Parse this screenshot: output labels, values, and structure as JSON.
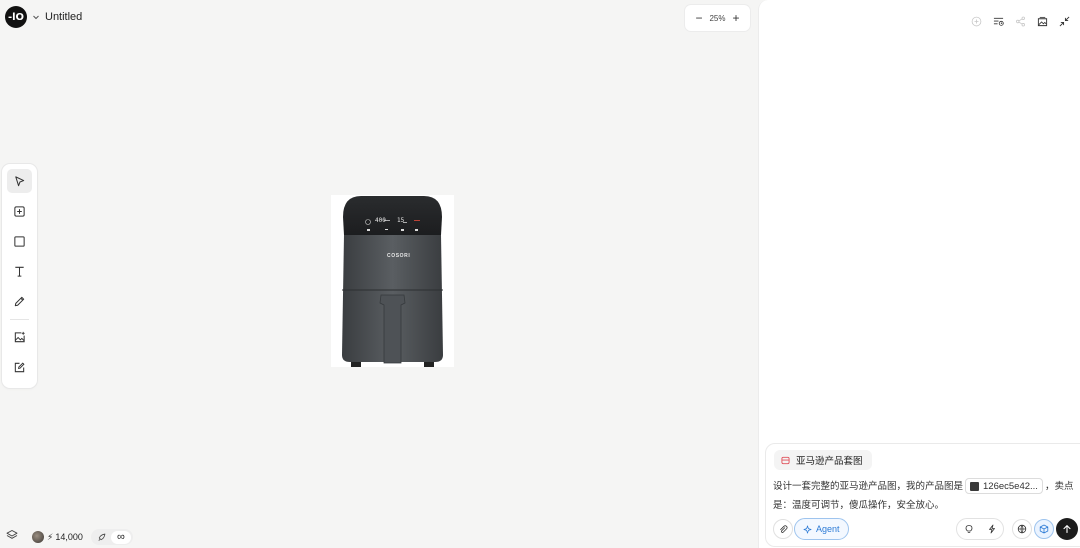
{
  "app": {
    "logo_text": "-lO",
    "document_title": "Untitled"
  },
  "zoom": {
    "value": "25%",
    "minus": "−",
    "plus": "+"
  },
  "toolbar": {
    "tools": [
      "select",
      "frame",
      "rectangle",
      "text",
      "pen",
      "image-generate",
      "image-edit"
    ],
    "active_tool": "select"
  },
  "canvas": {
    "product_brand": "COSORI",
    "display_readout": "400",
    "display_time": "15"
  },
  "status": {
    "credits": "14,000",
    "infinity": "∞"
  },
  "composer": {
    "skill_label": "亚马逊产品套图",
    "prompt_before": "设计一套完整的亚马逊产品图，我的产品图是",
    "file_name": "126ec5e42...",
    "prompt_after": "，卖点是：温度可调节，傻瓜操作，安全放心。",
    "agent_label": "Agent"
  },
  "colors": {
    "accent": "#2d7bd6",
    "skill_icon": "#e0505a",
    "canvas_bg": "#f5f5f4"
  }
}
